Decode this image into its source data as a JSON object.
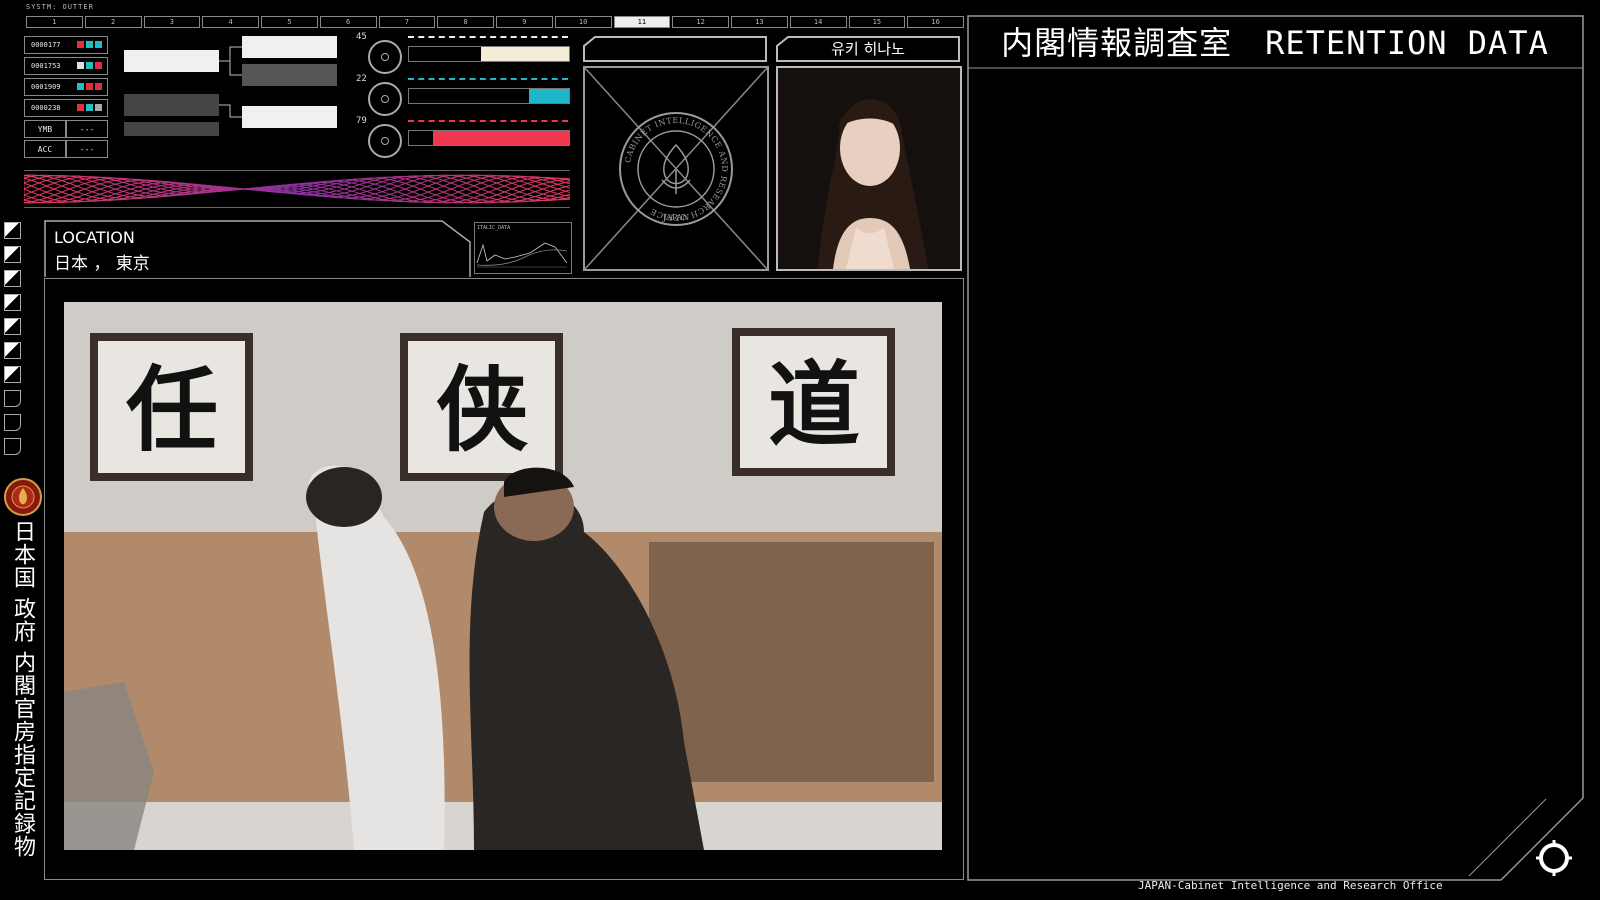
{
  "header": {
    "system_label": "SYSTM: OUTTER",
    "tabs": [
      "1",
      "2",
      "3",
      "4",
      "5",
      "6",
      "7",
      "8",
      "9",
      "10",
      "11",
      "12",
      "13",
      "14",
      "15",
      "16"
    ],
    "active_tab": 10
  },
  "codes": [
    {
      "id": "0000177",
      "colors": [
        "#e03040",
        "#20c0c0",
        "#20c0c0"
      ]
    },
    {
      "id": "0001753",
      "colors": [
        "#e0e0e0",
        "#20c0c0",
        "#e03040"
      ]
    },
    {
      "id": "0001909",
      "colors": [
        "#20c0c0",
        "#e03040",
        "#e03040"
      ]
    },
    {
      "id": "0000238",
      "colors": [
        "#e03040",
        "#20c0c0",
        "#aaaaaa"
      ]
    }
  ],
  "buttons": [
    {
      "label": "YMB",
      "value": "---"
    },
    {
      "label": "ACC",
      "value": "---"
    }
  ],
  "gauges": [
    {
      "num": "45",
      "color": "#f2ecd8",
      "level": 0.55
    },
    {
      "num": "22",
      "color": "#20b8c8",
      "level": 0.25
    },
    {
      "num": "79",
      "color": "#ef3850",
      "level": 0.85
    }
  ],
  "location": {
    "label": "LOCATION",
    "value": "日本 ， 東京"
  },
  "graph": {
    "title": "ITALIC_DATA"
  },
  "emblem": {
    "ring_text": "CABINET INTELLIGENCE AND RESEARCH OFFICE",
    "bottom_text": "JAPAN"
  },
  "profile": {
    "name": "유키 히나노"
  },
  "right": {
    "title": "内閣情報調査室　RETENTION DATA"
  },
  "side": {
    "vertical_text": "日本国 政府 内閣官房指定記録物"
  },
  "photo": {
    "calligraphy": [
      "任",
      "侠",
      "道"
    ]
  },
  "footer": {
    "text": "JAPAN-Cabinet Intelligence and Research Office"
  },
  "colors": {
    "accent_red": "#ef3850",
    "accent_cyan": "#20b8c8",
    "frame": "#8a8a8a"
  }
}
